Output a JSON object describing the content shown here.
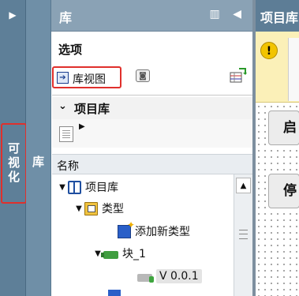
{
  "left_strips": {
    "strip1_arrow": "▶",
    "strip1_label": "可视化",
    "strip2_label": "库"
  },
  "library_panel": {
    "title": "库",
    "header_icons": "▥ ◀",
    "options_title": "选项",
    "library_view_label": "库视图",
    "project_library_title": "项目库",
    "column_header": "名称",
    "tree": [
      {
        "label": "项目库",
        "toggle": "▼",
        "icon": "book-icon"
      },
      {
        "label": "类型",
        "toggle": "▼",
        "icon": "folder-icon"
      },
      {
        "label": "添加新类型",
        "toggle": "",
        "icon": "add-type-icon"
      },
      {
        "label": "块_1",
        "toggle": "▼",
        "icon": "block-icon"
      },
      {
        "label": "V 0.0.1",
        "toggle": "",
        "icon": "version-icon"
      }
    ]
  },
  "right_panel": {
    "title": "项目库",
    "warning_symbol": "!",
    "button1_label": "启",
    "button2_label": "停"
  },
  "colors": {
    "highlight": "#e0302c",
    "header_blue": "#8aa2b5",
    "warning_bg": "#fbf0b8"
  }
}
